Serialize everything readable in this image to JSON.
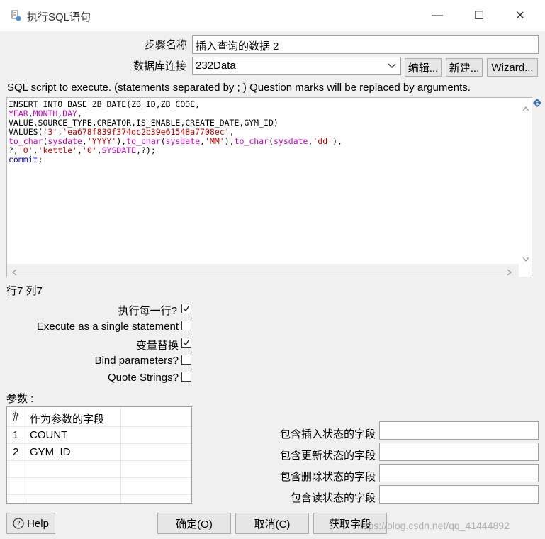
{
  "window": {
    "title": "执行SQL语句",
    "minimize": "—",
    "maximize": "☐",
    "close": "✕"
  },
  "form": {
    "step_name_label": "步骤名称",
    "step_name_value": "插入查询的数据 2",
    "db_conn_label": "数据库连接",
    "db_conn_value": "232Data",
    "edit_button": "编辑...",
    "new_button": "新建...",
    "wizard_button": "Wizard..."
  },
  "sql": {
    "caption": "SQL script to execute. (statements separated by ; ) Question marks will be replaced by arguments.",
    "status": "行7 列7"
  },
  "options": {
    "execute_each_row": "执行每一行?",
    "execute_single": "Execute as a single statement",
    "variable_substitution": "变量替换",
    "bind_parameters": "Bind parameters?",
    "quote_strings": "Quote Strings?",
    "states": [
      true,
      false,
      true,
      false,
      false
    ]
  },
  "params": {
    "label": "参数 :",
    "col_hash": "#",
    "col_field": "作为参数的字段",
    "rows": [
      {
        "num": "1",
        "field": "COUNT"
      },
      {
        "num": "2",
        "field": "GYM_ID"
      }
    ]
  },
  "status_fields": {
    "insert_label": "包含插入状态的字段",
    "update_label": "包含更新状态的字段",
    "delete_label": "包含删除状态的字段",
    "read_label": "包含读状态的字段"
  },
  "footer": {
    "help": "Help",
    "ok": "确定(O)",
    "cancel": "取消(C)",
    "get_fields": "获取字段",
    "watermark": "https://blog.csdn.net/qq_41444892"
  },
  "colors": {
    "keyword_fn": "#c800c8",
    "string": "#c80000",
    "commit": "#0000c8"
  }
}
